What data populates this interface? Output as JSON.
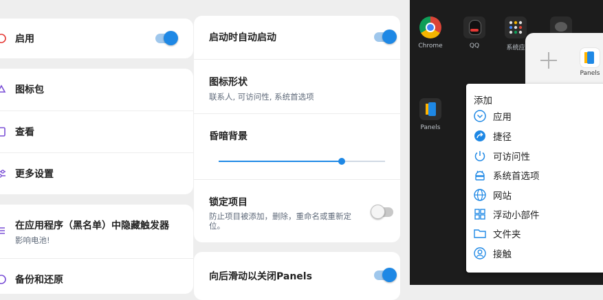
{
  "left_menu": {
    "enable": "启用",
    "icon_pack": "图标包",
    "view": "查看",
    "more_settings": "更多设置",
    "hide_in_blacklist": "在应用程序（黑名单）中隐藏触发器",
    "hide_in_blacklist_sub": "影响电池!",
    "backup_restore": "备份和还原"
  },
  "settings": {
    "auto_start": "启动时自动启动",
    "icon_shape": "图标形状",
    "icon_shape_sub": "联系人, 可访问性, 系统首选项",
    "dim_background": "昏暗背景",
    "dim_level": 0.74,
    "lock_items": "锁定项目",
    "lock_items_sub": "防止项目被添加，删除，重命名或重新定位。",
    "swipe_back_close": "向后滑动以关闭Panels"
  },
  "toggles": {
    "enable": true,
    "auto_start": true,
    "lock_items": false,
    "swipe_back_close": true
  },
  "preview": {
    "apps": [
      {
        "name": "Chrome",
        "icon": "chrome-icon"
      },
      {
        "name": "QQ",
        "icon": "qq-icon"
      },
      {
        "name": "系统应",
        "icon": "apps-grid-icon"
      },
      {
        "name": "",
        "icon": "wechat-icon"
      }
    ],
    "panels_app": "Panels",
    "tray_label": "Panels",
    "add_menu": {
      "title": "添加",
      "items": [
        {
          "label": "应用",
          "icon": "chevron-circle-icon"
        },
        {
          "label": "捷径",
          "icon": "shortcut-arrow-icon"
        },
        {
          "label": "可访问性",
          "icon": "power-icon"
        },
        {
          "label": "系统首选项",
          "icon": "android-icon"
        },
        {
          "label": "网站",
          "icon": "globe-icon"
        },
        {
          "label": "浮动小部件",
          "icon": "widgets-icon"
        },
        {
          "label": "文件夹",
          "icon": "folder-icon"
        },
        {
          "label": "接触",
          "icon": "contact-icon"
        }
      ]
    }
  },
  "colors": {
    "accent": "#1e88e5",
    "left_icon": "#7a4fd6",
    "dark_bg": "#1c1c1c"
  }
}
